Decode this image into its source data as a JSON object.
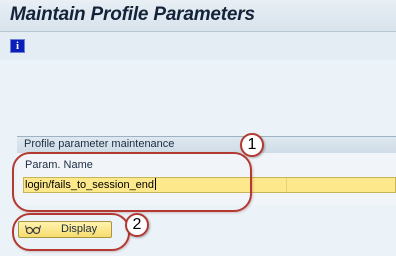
{
  "header": {
    "title": "Maintain Profile Parameters"
  },
  "toolbar": {
    "info_icon": "info-icon",
    "info_glyph": "i"
  },
  "group": {
    "title": "Profile parameter maintenance",
    "field_label": "Param. Name",
    "field_value": "login/fails_to_session_end"
  },
  "actions": {
    "display_label": "Display",
    "display_icon": "glasses-icon"
  },
  "callouts": [
    {
      "number": "1"
    },
    {
      "number": "2"
    }
  ],
  "colors": {
    "callout": "#b23a32",
    "input_highlight": "#fde98b",
    "info_icon": "#0a1fb8"
  }
}
